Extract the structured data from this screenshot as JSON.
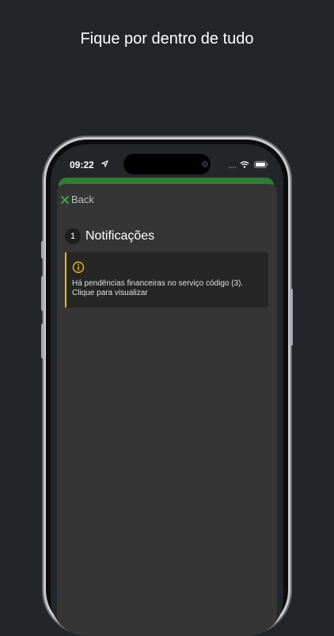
{
  "headline": "Fique por dentro de tudo",
  "status_bar": {
    "time": "09:22",
    "signal": "....",
    "icons": [
      "location-arrow-icon",
      "wifi-icon",
      "battery-icon"
    ]
  },
  "nav": {
    "back_label": "Back",
    "back_icon": "close-x-icon"
  },
  "notifications": {
    "count": "1",
    "title": "Notificações",
    "items": [
      {
        "icon": "info-circle-icon",
        "line1": "Há pendências financeiras no serviço código (3).",
        "line2": "Clique para visualizar"
      }
    ]
  },
  "colors": {
    "background": "#232629",
    "accent_green": "#2e7d32",
    "warning_yellow": "#f2b90f",
    "sheet": "#353535",
    "card": "#262626"
  }
}
